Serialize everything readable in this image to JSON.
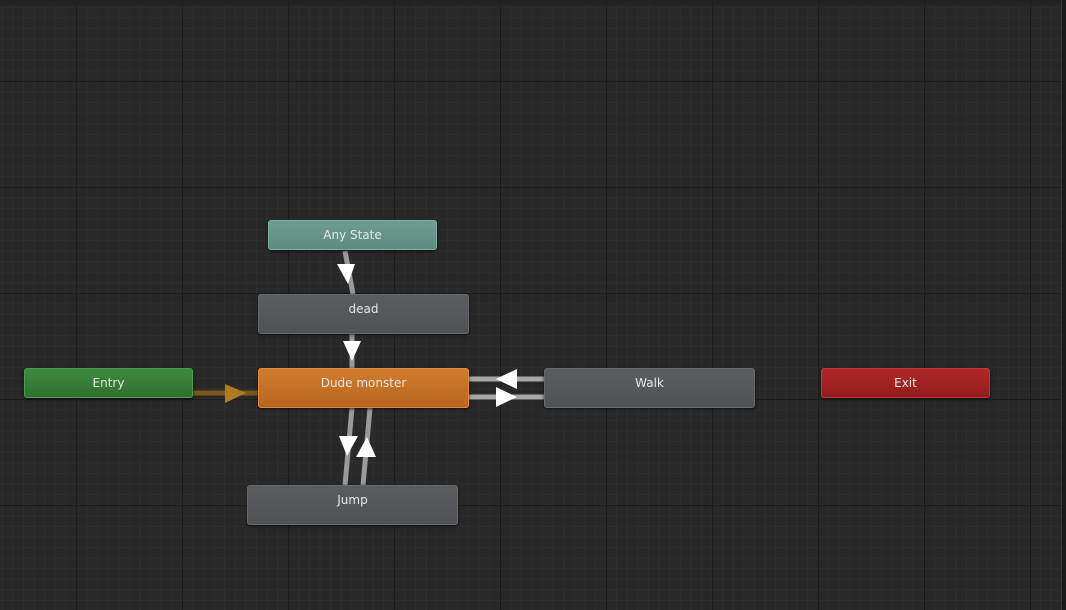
{
  "graph": {
    "states": {
      "any_state": "Any State",
      "dead": "dead",
      "entry": "Entry",
      "dude_monster": "Dude monster",
      "walk": "Walk",
      "exit": "Exit",
      "jump": "Jump"
    },
    "colors": {
      "background": "#282828",
      "grid_major": "#1c1c1c",
      "grid_minor": "#2f2f2f",
      "any_state": "#64958a",
      "entry": "#367d36",
      "default_state": "#d07d30",
      "state": "#55575b",
      "exit": "#a52222",
      "transition": "#c8c8c8",
      "entry_transition": "#a06c1c"
    }
  }
}
